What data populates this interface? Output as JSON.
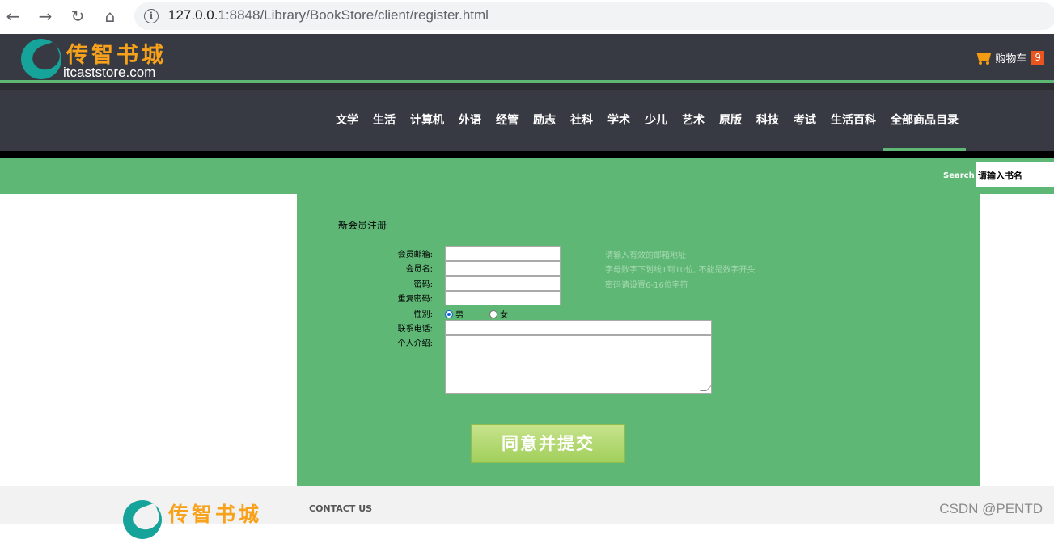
{
  "browser": {
    "url_host": "127.0.0.1",
    "url_rest": ":8848/Library/BookStore/client/register.html"
  },
  "header": {
    "logo_cn": "传智书城",
    "logo_en": "itcaststore.com",
    "cart_label": "购物车",
    "cart_count": "9"
  },
  "menu": {
    "items": [
      "文学",
      "生活",
      "计算机",
      "外语",
      "经管",
      "励志",
      "社科",
      "学术",
      "少儿",
      "艺术",
      "原版",
      "科技",
      "考试",
      "生活百科",
      "全部商品目录"
    ],
    "active_index": 14
  },
  "search": {
    "label": "Search",
    "value": "请输入书名"
  },
  "form": {
    "title": "新会员注册",
    "labels": {
      "email": "会员邮箱:",
      "username": "会员名:",
      "password": "密码:",
      "repassword": "重复密码:",
      "gender": "性别:",
      "phone": "联系电话:",
      "intro": "个人介绍:"
    },
    "gender_options": [
      "男",
      "女"
    ],
    "gender_selected": "男",
    "hints": [
      "请输入有效的邮箱地址",
      "字母数字下划线1到10位, 不能是数字开头",
      "密码请设置6-16位字符"
    ],
    "submit_label": "同意并提交"
  },
  "footer": {
    "logo_cn": "传智书城",
    "contact_label": "CONTACT US",
    "watermark": "CSDN @PENTD"
  }
}
